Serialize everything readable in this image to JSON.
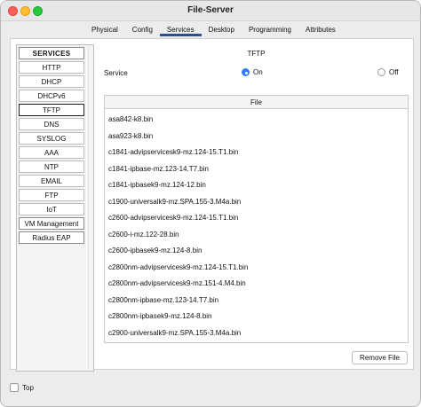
{
  "window": {
    "title": "File-Server"
  },
  "tabs": [
    {
      "label": "Physical"
    },
    {
      "label": "Config"
    },
    {
      "label": "Services"
    },
    {
      "label": "Desktop"
    },
    {
      "label": "Programming"
    },
    {
      "label": "Attributes"
    }
  ],
  "active_tab": "Services",
  "sidebar": {
    "heading": "SERVICES",
    "items": [
      {
        "label": "HTTP"
      },
      {
        "label": "DHCP"
      },
      {
        "label": "DHCPv6"
      },
      {
        "label": "TFTP"
      },
      {
        "label": "DNS"
      },
      {
        "label": "SYSLOG"
      },
      {
        "label": "AAA"
      },
      {
        "label": "NTP"
      },
      {
        "label": "EMAIL"
      },
      {
        "label": "FTP"
      },
      {
        "label": "IoT"
      },
      {
        "label": "VM Management"
      },
      {
        "label": "Radius EAP"
      }
    ],
    "selected": "TFTP"
  },
  "panel": {
    "title": "TFTP",
    "service_label": "Service",
    "on_label": "On",
    "off_label": "Off",
    "service_state": "On",
    "file_header": "File",
    "files": [
      "asa842-k8.bin",
      "asa923-k8.bin",
      "c1841-advipservicesk9-mz.124-15.T1.bin",
      "c1841-ipbase-mz.123-14.T7.bin",
      "c1841-ipbasek9-mz.124-12.bin",
      "c1900-universalk9-mz.SPA.155-3.M4a.bin",
      "c2600-advipservicesk9-mz.124-15.T1.bin",
      "c2600-i-mz.122-28.bin",
      "c2600-ipbasek9-mz.124-8.bin",
      "c2800nm-advipservicesk9-mz.124-15.T1.bin",
      "c2800nm-advipservicesk9-mz.151-4.M4.bin",
      "c2800nm-ipbase-mz.123-14.T7.bin",
      "c2800nm-ipbasek9-mz.124-8.bin",
      "c2900-universalk9-mz.SPA.155-3.M4a.bin"
    ],
    "remove_button": "Remove File"
  },
  "footer": {
    "top_label": "Top",
    "top_checked": false
  },
  "colors": {
    "radio_selected": "#2f7ff6",
    "active_tab_underline": "#2d4f8f",
    "close": "#ff5f57",
    "minimize": "#febc2e",
    "maximize": "#28c840"
  }
}
